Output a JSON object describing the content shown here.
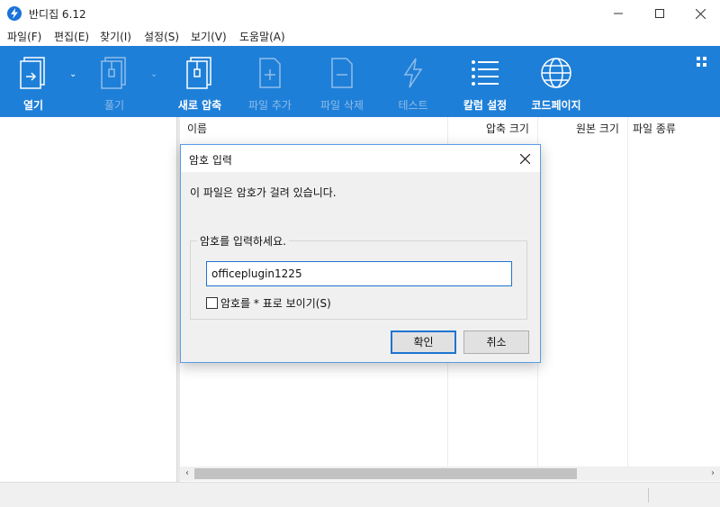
{
  "app": {
    "title": "반디집 6.12"
  },
  "menu": [
    "파일(F)",
    "편집(E)",
    "찾기(I)",
    "설정(S)",
    "보기(V)",
    "도움말(A)"
  ],
  "toolbar": {
    "open": "열기",
    "extract": "풀기",
    "new_archive": "새로 압축",
    "add_file": "파일 추가",
    "delete_file": "파일 삭제",
    "test": "테스트",
    "column_settings": "칼럼 설정",
    "codepage": "코드페이지"
  },
  "file_list": {
    "columns": [
      "이름",
      "압축 크기",
      "원본 크기",
      "파일 종류"
    ]
  },
  "dialog": {
    "title": "암호 입력",
    "message": "이 파일은 암호가 걸려 있습니다.",
    "group_label": "암호를 입력하세요.",
    "password_value": "officeplugin1225",
    "show_password_label": "암호를 * 표로 보이기(S)",
    "ok_label": "확인",
    "cancel_label": "취소"
  },
  "colors": {
    "toolbar_bg": "#1e7fd8",
    "accent": "#1f74d0"
  }
}
